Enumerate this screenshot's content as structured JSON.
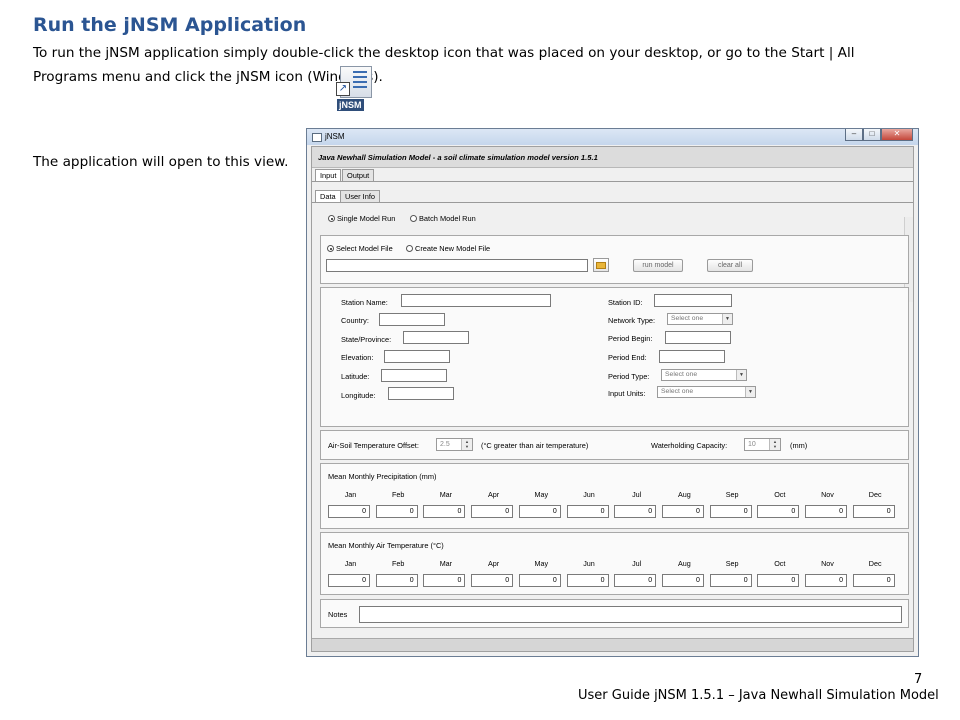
{
  "document": {
    "heading": "Run the jNSM Application",
    "intro": "To run the jNSM application simply double-click the desktop icon that was placed on your desktop, or go to the Start | All Programs menu and click the jNSM icon (Windows).",
    "icon_label": "jNSM",
    "open_text": "The application will open to this view.",
    "page_number": "7",
    "footer": "User Guide jNSM 1.5.1 – Java Newhall Simulation Model"
  },
  "app": {
    "window_title": "jNSM",
    "window_buttons": [
      "–",
      "□",
      "✕"
    ],
    "header": "Java Newhall Simulation Model - a soil climate simulation model    version 1.5.1",
    "main_tabs": [
      "Input",
      "Output"
    ],
    "sub_tabs": [
      "Data",
      "User Info"
    ],
    "run_mode": {
      "single": "Single Model Run",
      "batch": "Batch Model Run",
      "selected": "single"
    },
    "model_file": {
      "select": "Select Model File",
      "create": "Create New Model File",
      "selected": "select",
      "path_value": ""
    },
    "buttons": {
      "run_model": "run model",
      "clear_all": "clear all"
    },
    "station": {
      "name_label": "Station Name:",
      "country_label": "Country:",
      "state_label": "State/Province:",
      "elevation_label": "Elevation:",
      "latitude_label": "Latitude:",
      "longitude_label": "Longitude:",
      "id_label": "Station ID:",
      "network_label": "Network Type:",
      "period_begin_label": "Period Begin:",
      "period_end_label": "Period End:",
      "period_type_label": "Period Type:",
      "input_units_label": "Input Units:",
      "select_placeholder": "Select one"
    },
    "offsets": {
      "air_soil_label": "Air-Soil Temperature Offset:",
      "air_soil_value": "2.5",
      "air_soil_unit": "(°C greater than air temperature)",
      "water_label": "Waterholding Capacity:",
      "water_value": "10",
      "water_unit": "(mm)"
    },
    "months": [
      "Jan",
      "Feb",
      "Mar",
      "Apr",
      "May",
      "Jun",
      "Jul",
      "Aug",
      "Sep",
      "Oct",
      "Nov",
      "Dec"
    ],
    "precipitation": {
      "title": "Mean Monthly Precipitation (mm)",
      "values": [
        "0",
        "0",
        "0",
        "0",
        "0",
        "0",
        "0",
        "0",
        "0",
        "0",
        "0",
        "0"
      ]
    },
    "temperature": {
      "title": "Mean Monthly Air Temperature (°C)",
      "values": [
        "0",
        "0",
        "0",
        "0",
        "0",
        "0",
        "0",
        "0",
        "0",
        "0",
        "0",
        "0"
      ]
    },
    "notes_label": "Notes"
  }
}
